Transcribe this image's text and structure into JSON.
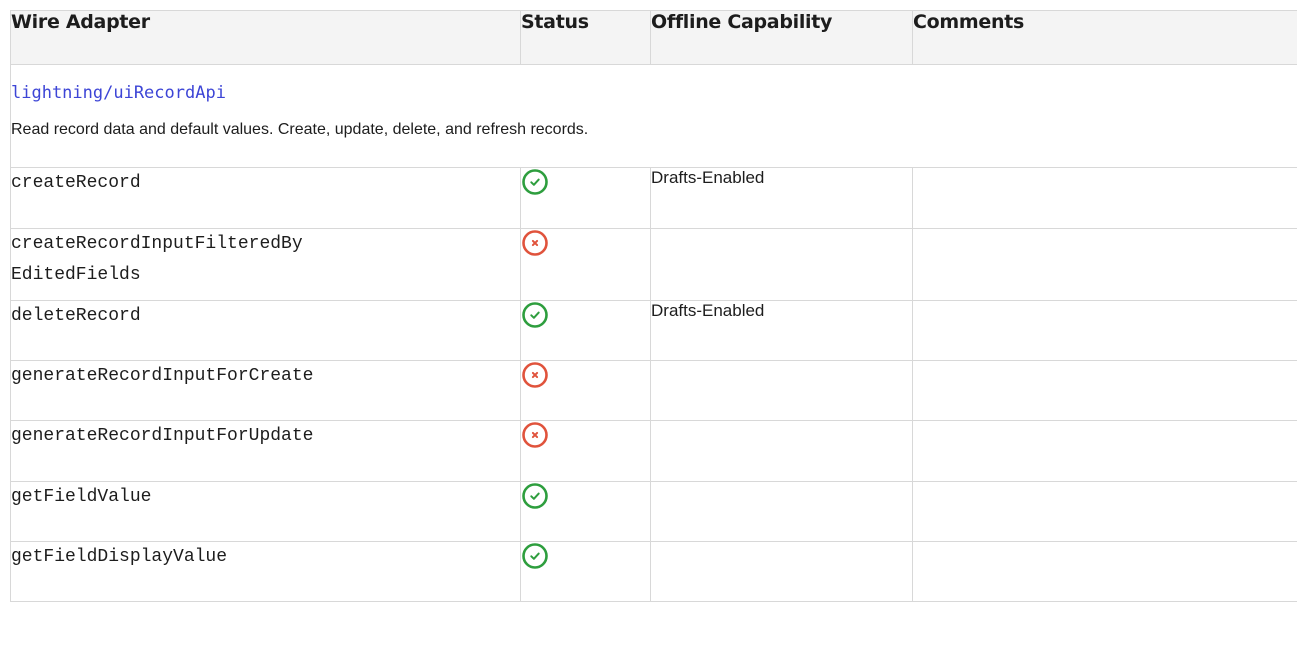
{
  "table": {
    "headers": [
      "Wire Adapter",
      "Status",
      "Offline Capability",
      "Comments"
    ],
    "section": {
      "module": "lightning/uiRecordApi",
      "description": "Read record data and default values. Create, update, delete, and refresh records."
    },
    "rows": [
      {
        "name_lines": [
          "createRecord"
        ],
        "status": "supported",
        "status_icon": "check-circle-icon",
        "offline": "Drafts-Enabled",
        "comments": ""
      },
      {
        "name_lines": [
          "createRecordInputFilteredBy",
          "EditedFields"
        ],
        "status": "not-supported",
        "status_icon": "x-circle-icon",
        "offline": "",
        "comments": ""
      },
      {
        "name_lines": [
          "deleteRecord"
        ],
        "status": "supported",
        "status_icon": "check-circle-icon",
        "offline": "Drafts-Enabled",
        "comments": ""
      },
      {
        "name_lines": [
          "generateRecordInputForCreate"
        ],
        "status": "not-supported",
        "status_icon": "x-circle-icon",
        "offline": "",
        "comments": ""
      },
      {
        "name_lines": [
          "generateRecordInputForUpdate"
        ],
        "status": "not-supported",
        "status_icon": "x-circle-icon",
        "offline": "",
        "comments": ""
      },
      {
        "name_lines": [
          "getFieldValue"
        ],
        "status": "supported",
        "status_icon": "check-circle-icon",
        "offline": "",
        "comments": ""
      },
      {
        "name_lines": [
          "getFieldDisplayValue"
        ],
        "status": "supported",
        "status_icon": "check-circle-icon",
        "offline": "",
        "comments": ""
      }
    ]
  },
  "colors": {
    "supported": "#2e9e3e",
    "not_supported": "#e0533c",
    "link": "#3d45d6",
    "header_bg": "#f4f4f4",
    "border": "#d8d8d8"
  }
}
